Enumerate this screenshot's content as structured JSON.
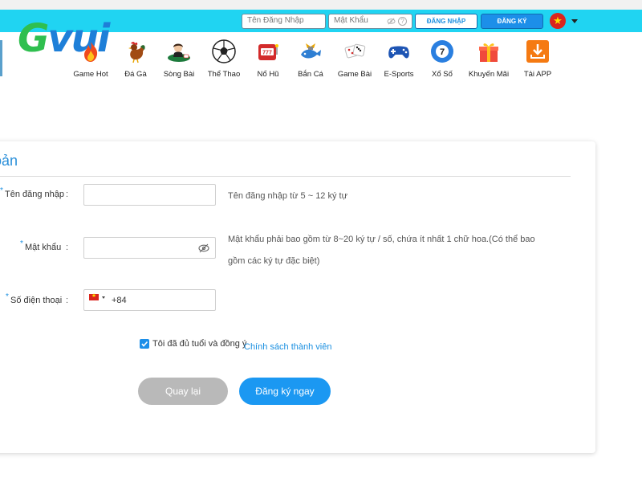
{
  "topbar": {
    "username_placeholder": "Tên Đăng Nhập",
    "password_placeholder": "Mật Khẩu",
    "help_glyph": "?",
    "login_label": "ĐĂNG NHẬP",
    "register_label": "ĐĂNG KÝ",
    "language_flag_icon": "vietnam-flag-icon",
    "accent_color": "#20d4f2"
  },
  "logo": {
    "text_g": "G",
    "text_rest": "vui"
  },
  "nav": [
    {
      "label": "Game Hot",
      "icon": "fire-icon"
    },
    {
      "label": "Đá Gà",
      "icon": "rooster-icon"
    },
    {
      "label": "Sòng Bài",
      "icon": "dealer-icon"
    },
    {
      "label": "Thể Thao",
      "icon": "soccer-ball-icon"
    },
    {
      "label": "Nổ Hũ",
      "icon": "slot-machine-icon"
    },
    {
      "label": "Bắn Cá",
      "icon": "fish-shooting-icon"
    },
    {
      "label": "Game Bài",
      "icon": "dice-icon"
    },
    {
      "label": "E-Sports",
      "icon": "gamepad-icon"
    },
    {
      "label": "Xổ Số",
      "icon": "lottery-ball-icon"
    },
    {
      "label": "Khuyến Mãi",
      "icon": "gift-icon"
    },
    {
      "label": "Tải APP",
      "icon": "download-icon"
    }
  ],
  "lottery_number": "7",
  "slot_number": "777",
  "form": {
    "title": "oản",
    "required_mark": "*",
    "colon": ":",
    "username_label": "Tên đăng nhập",
    "username_value": "",
    "username_hint": "Tên đăng nhập từ 5 ~ 12 ký tự",
    "password_label": "Mật khẩu",
    "password_value": "",
    "password_hint_line1": "Mật khẩu phải bao gồm từ 8~20 ký tự / số, chứa ít nhất 1 chữ hoa.(Có thể bao",
    "password_hint_line2": "gồm các ký tự đặc biệt)",
    "phone_label": "Số điện thoại",
    "phone_code": "+84",
    "agree_text": "Tôi đã đủ tuổi và đồng ý",
    "policy_link": "Chính sách thành viên",
    "agree_checked": true,
    "back_label": "Quay lại",
    "submit_label": "Đăng ký ngay",
    "primary_color": "#1b98f2",
    "secondary_color": "#b9b9b9"
  }
}
